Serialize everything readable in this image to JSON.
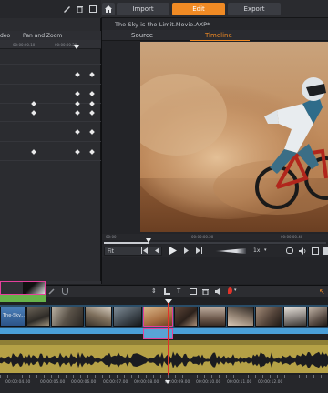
{
  "top_bar": {
    "import_label": "Import",
    "edit_label": "Edit",
    "export_label": "Export"
  },
  "left_panel": {
    "tab_video_label": "deo",
    "tab_pan_zoom_label": "Pan and Zoom",
    "ruler_ticks": [
      "00:00:00.10",
      "00:00:00.20"
    ]
  },
  "preview": {
    "title": "The-Sky-is-the-Limit.Movie.AXP*",
    "tab_source_label": "Source",
    "tab_timeline_label": "Timeline",
    "ruler_ticks": [
      "00:00",
      "00:00:00.20",
      "00:00:00.40"
    ],
    "fit_label": "Fit",
    "speed_label": "1x",
    "playhead_fraction": 0.2
  },
  "timeline": {
    "clip_label": "The-Sky...",
    "ruler_ticks": [
      "00:00:04.00",
      "00:00:05.00",
      "00:00:06.00",
      "00:00:07.00",
      "00:00:08.00",
      "00:00:09.00",
      "00:00:10.00",
      "00:00:11.00",
      "00:00:12.00"
    ]
  },
  "colors": {
    "accent_orange": "#f08a24",
    "playhead_red": "#e2332a",
    "audio_yellow": "#b5a146",
    "video_track_blue": "#4a9fd8",
    "overlay_green": "#67b34a",
    "selection_magenta": "#e4409c"
  }
}
